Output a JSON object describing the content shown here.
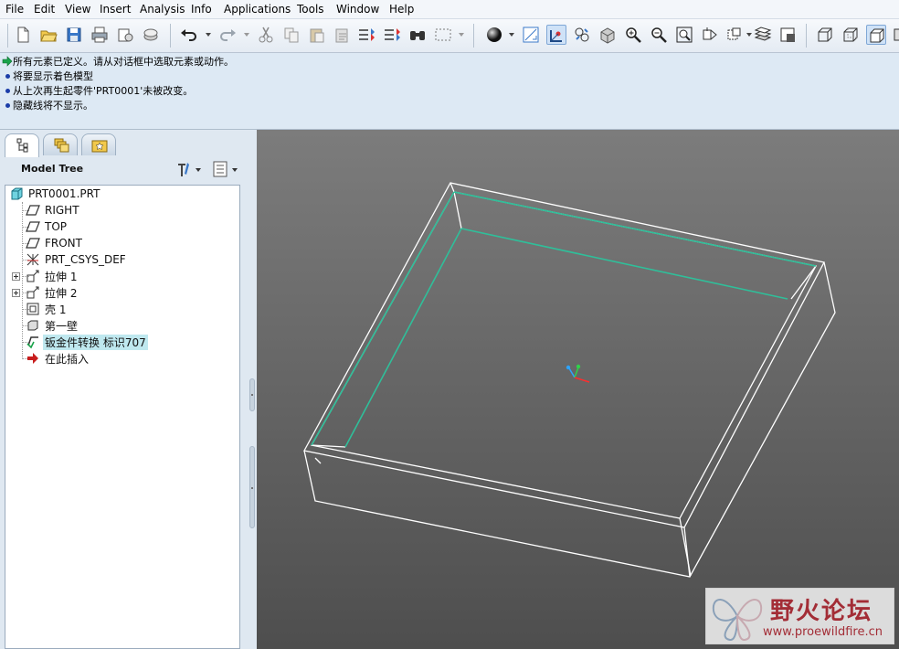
{
  "menu": [
    "File",
    "Edit",
    "View",
    "Insert",
    "Analysis",
    "Info",
    "Applications",
    "Tools",
    "Window",
    "Help"
  ],
  "toolbar": {
    "icons": [
      "new-icon",
      "open-icon",
      "save-icon",
      "print-icon",
      "send-icon",
      "erase-icon",
      "undo-icon",
      "redo-icon",
      "cut-icon",
      "copy-icon",
      "paste-icon",
      "paste-special-icon",
      "regenerate-icon",
      "regen-manager-icon",
      "find-icon",
      "select-box-icon",
      "shading-icon",
      "datum-display-icon",
      "spin-center-icon",
      "saved-views-icon",
      "reorient-icon",
      "zoom-in-icon",
      "zoom-out-icon",
      "refit-icon",
      "view-manager-icon",
      "layers-icon",
      "appearance-icon",
      "wireframe-icon",
      "hidden-line-icon",
      "no-hidden-icon"
    ]
  },
  "messages": [
    {
      "type": "ok",
      "text": "所有元素已定义。请从对话框中选取元素或动作。"
    },
    {
      "type": "info",
      "text": "将要显示着色模型"
    },
    {
      "type": "info",
      "text": "从上次再生起零件'PRT0001'未被改变。"
    },
    {
      "type": "info",
      "text": "隐藏线将不显示。"
    }
  ],
  "left_panel": {
    "tabs": [
      "model-tree-tab",
      "folder-browser-tab",
      "favorites-tab"
    ],
    "title": "Model Tree"
  },
  "tree": {
    "root": "PRT0001.PRT",
    "items": [
      {
        "label": "RIGHT",
        "icon": "datum-plane-icon"
      },
      {
        "label": "TOP",
        "icon": "datum-plane-icon"
      },
      {
        "label": "FRONT",
        "icon": "datum-plane-icon"
      },
      {
        "label": "PRT_CSYS_DEF",
        "icon": "csys-icon"
      },
      {
        "label": "拉伸 1",
        "icon": "extrude-icon"
      },
      {
        "label": "拉伸 2",
        "icon": "extrude-icon"
      },
      {
        "label": "壳 1",
        "icon": "shell-icon"
      },
      {
        "label": "第一壁",
        "icon": "first-wall-icon"
      },
      {
        "label": "钣金件转换 标识707",
        "icon": "sheetmetal-convert-icon"
      },
      {
        "label": "在此插入",
        "icon": "insert-here-icon"
      }
    ]
  },
  "watermark": {
    "title": "野火论坛",
    "url": "www.proewildfire.cn"
  },
  "colors": {
    "viewport_top": "#7c7c7c",
    "viewport_bottom": "#4e4e4e",
    "edge": "#ffffff",
    "tangent_edge": "#2fbf9a",
    "highlight": "#bfe8ef",
    "watermark_red": "#a32d36"
  }
}
